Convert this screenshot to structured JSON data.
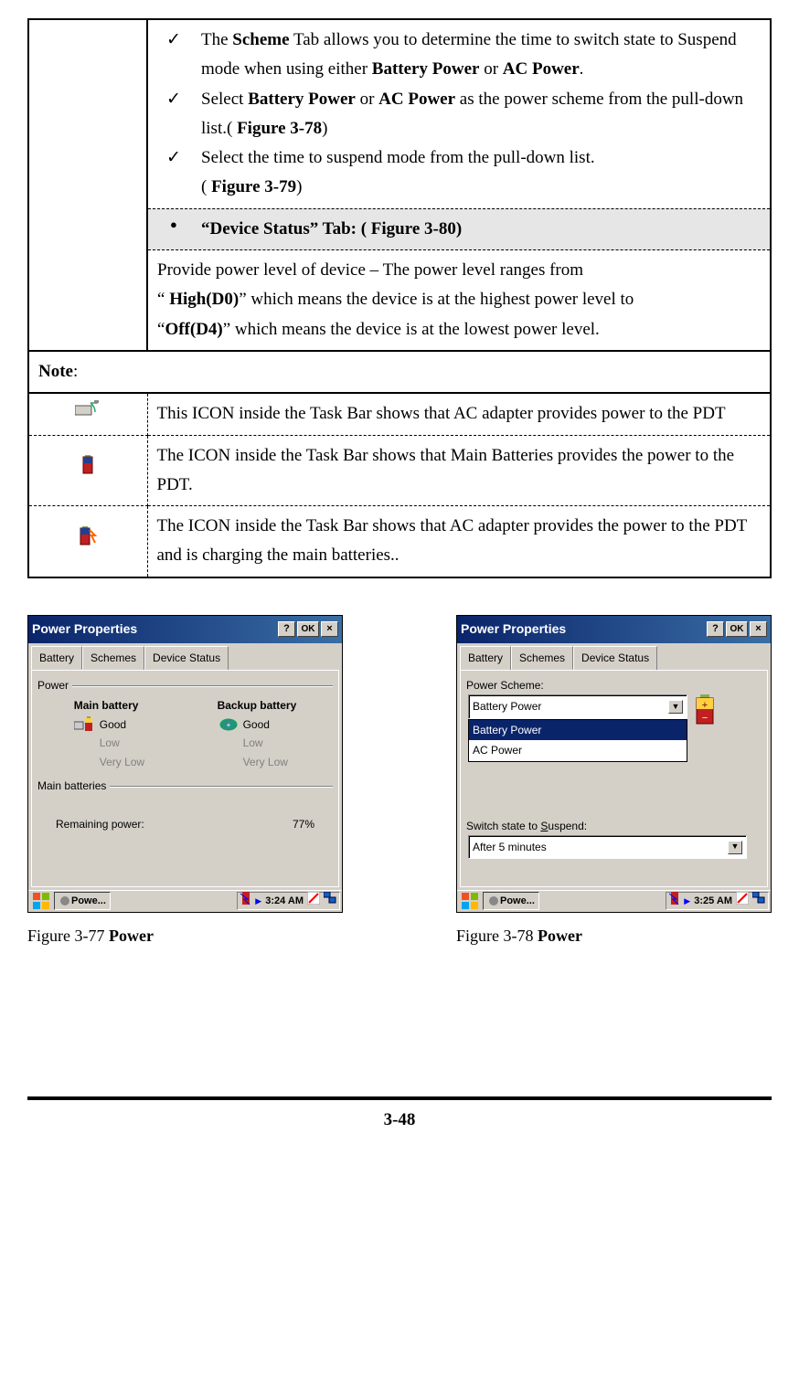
{
  "row1": {
    "item1": {
      "pre": "The ",
      "b1": "Scheme",
      "mid1": " Tab allows you to determine the time to switch state to Suspend mode when using either ",
      "b2": "Battery Power",
      "mid2": " or ",
      "b3": "AC Power",
      "post": "."
    },
    "item2": {
      "pre": "Select ",
      "b1": "Battery Power",
      "mid1": " or ",
      "b2": "AC Power",
      "mid2": " as the power scheme from the pull-down list.( ",
      "b3": "Figure 3-78",
      "post": ")"
    },
    "item3": {
      "line1": "Select the time to suspend mode from the pull-down list.",
      "line2pre": "( ",
      "line2b": "Figure 3-79",
      "line2post": ")"
    }
  },
  "row2": {
    "pre": "“Device Status” Tab: ( ",
    "fig": "Figure 3-80)",
    "post": ""
  },
  "row3": {
    "line1": "Provide power level of device – The power level ranges from",
    "l2a": "“ ",
    "l2b": "High(D0)",
    "l2c": "” which means the device is at the highest power level to",
    "l3a": "“",
    "l3b": "Off(D4)",
    "l3c": "” which means the device is at the lowest power level."
  },
  "note_label_b": "Note",
  "note_label_colon": ":",
  "icon_rows": [
    "This ICON inside the Task Bar shows that AC adapter provides power to the PDT",
    "The ICON inside the Task Bar shows that Main Batteries provides the power to the PDT.",
    "The ICON inside the Task Bar shows that AC adapter provides the power to the PDT and is charging the main batteries.."
  ],
  "fig77": {
    "title": "Power Properties",
    "tabs": [
      "Battery",
      "Schemes",
      "Device Status"
    ],
    "power_label": "Power",
    "main_head": "Main battery",
    "backup_head": "Backup battery",
    "levels": [
      "Good",
      "Low",
      "Very Low"
    ],
    "main_batt_label": "Main batteries",
    "remaining_label": "Remaining power:",
    "remaining_val": "77%",
    "task_label": "Powe...",
    "time": "3:24 AM",
    "caption_pre": "Figure 3-77 ",
    "caption_b": "Power"
  },
  "fig78": {
    "title": "Power Properties",
    "tabs": [
      "Battery",
      "Schemes",
      "Device Status"
    ],
    "scheme_label": "Power Scheme:",
    "dd_current": "Battery Power",
    "dd_options": [
      "Battery Power",
      "AC Power"
    ],
    "suspend_label_pre": "Switch state to ",
    "suspend_label_u": "S",
    "suspend_label_post": "uspend:",
    "suspend_val": "After 5 minutes",
    "task_label": "Powe...",
    "time": "3:25 AM",
    "caption_pre": "Figure 3-78 ",
    "caption_b": "Power"
  },
  "page_number": "3-48"
}
